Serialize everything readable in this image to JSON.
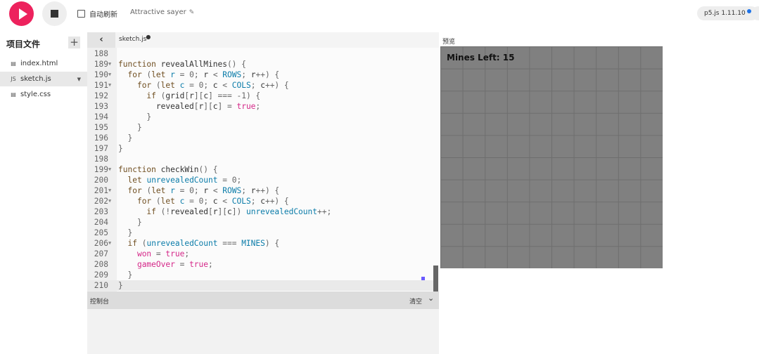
{
  "toolbar": {
    "autorefresh_label": "自动刷新",
    "autorefresh_checked": false,
    "sketch_name": "Attractive sayer",
    "version_label": "p5.js 1.11.10"
  },
  "sidebar": {
    "title": "项目文件",
    "add_label": "+",
    "files": [
      {
        "name": "index.html",
        "icon": "file-icon"
      },
      {
        "name": "sketch.js",
        "icon": "js-file-icon",
        "active": true
      },
      {
        "name": "style.css",
        "icon": "file-icon"
      }
    ]
  },
  "editor": {
    "tab_name": "sketch.js",
    "collapse_label": "‹",
    "lines": [
      {
        "n": "188",
        "text": ""
      },
      {
        "n": "189",
        "text": "function revealAllMines() {"
      },
      {
        "n": "190",
        "text": "  for (let r = 0; r < ROWS; r++) {"
      },
      {
        "n": "191",
        "text": "    for (let c = 0; c < COLS; c++) {"
      },
      {
        "n": "192",
        "text": "      if (grid[r][c] === -1) {"
      },
      {
        "n": "193",
        "text": "        revealed[r][c] = true;"
      },
      {
        "n": "194",
        "text": "      }"
      },
      {
        "n": "195",
        "text": "    }"
      },
      {
        "n": "196",
        "text": "  }"
      },
      {
        "n": "197",
        "text": "}"
      },
      {
        "n": "198",
        "text": ""
      },
      {
        "n": "199",
        "text": "function checkWin() {"
      },
      {
        "n": "200",
        "text": "  let unrevealedCount = 0;"
      },
      {
        "n": "201",
        "text": "  for (let r = 0; r < ROWS; r++) {"
      },
      {
        "n": "202",
        "text": "    for (let c = 0; c < COLS; c++) {"
      },
      {
        "n": "203",
        "text": "      if (!revealed[r][c]) unrevealedCount++;"
      },
      {
        "n": "204",
        "text": "    }"
      },
      {
        "n": "205",
        "text": "  }"
      },
      {
        "n": "206",
        "text": "  if (unrevealedCount === MINES) {"
      },
      {
        "n": "207",
        "text": "    won = true;"
      },
      {
        "n": "208",
        "text": "    gameOver = true;"
      },
      {
        "n": "209",
        "text": "  }"
      },
      {
        "n": "210",
        "text": "}"
      }
    ]
  },
  "console": {
    "title": "控制台",
    "clear_label": "清空"
  },
  "preview": {
    "label": "预览",
    "mines_left": "Mines Left: 15",
    "grid": {
      "rows": 10,
      "cols": 10
    }
  },
  "colors": {
    "accent": "#ed225d",
    "canvas_bg": "#808080"
  }
}
